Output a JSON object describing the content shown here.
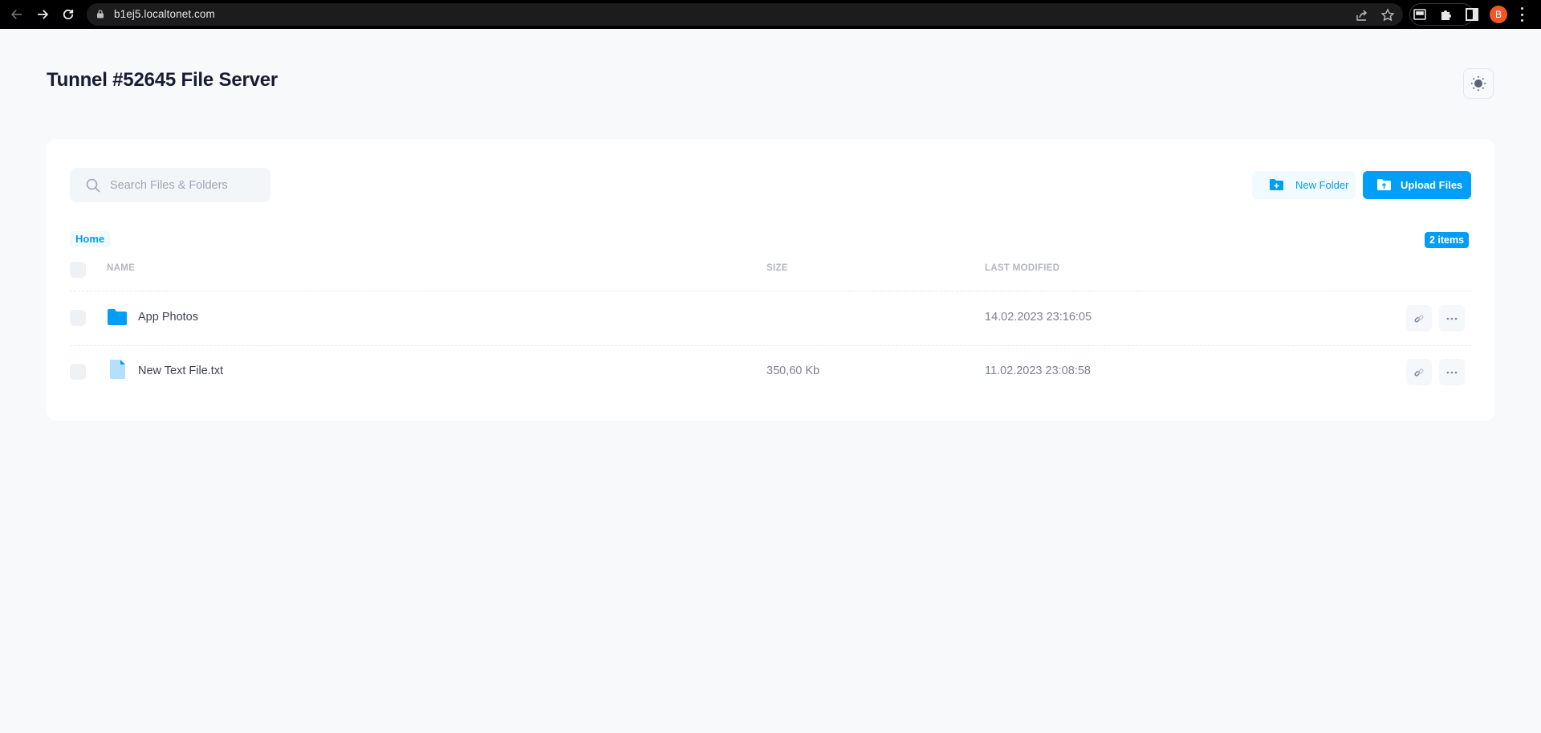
{
  "browser": {
    "url": "b1ej5.localtonet.com",
    "profile_initial": "B",
    "colors": {
      "profile": "#f1552a"
    }
  },
  "page": {
    "title": "Tunnel #52645 File Server",
    "theme_toggle": "sun-icon"
  },
  "toolbar": {
    "search_placeholder": "Search Files & Folders",
    "search_value": "",
    "new_folder_label": "New Folder",
    "upload_label": "Upload Files"
  },
  "breadcrumb": {
    "items": [
      "Home"
    ]
  },
  "item_count": "2 items",
  "table": {
    "columns": [
      "Name",
      "Size",
      "Last Modified"
    ],
    "rows": [
      {
        "type": "folder",
        "icon": "folder-icon",
        "name": "App Photos",
        "size": "",
        "modified": "14.02.2023 23:16:05"
      },
      {
        "type": "file",
        "icon": "file-icon",
        "name": "New Text File.txt",
        "size": "350,60 Kb",
        "modified": "11.02.2023 23:08:58"
      }
    ],
    "row_actions": [
      "copy-link-icon",
      "more-options-icon"
    ]
  },
  "colors": {
    "accent": "#009ef7",
    "accent_light": "#f1faff",
    "background": "#f8f9fb",
    "card": "#ffffff",
    "title": "#181c32",
    "muted": "#b5b5c3"
  }
}
